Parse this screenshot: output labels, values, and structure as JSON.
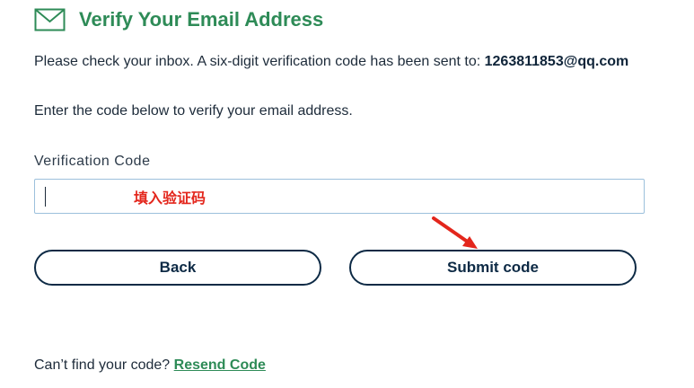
{
  "header": {
    "icon": "envelope-icon",
    "title": "Verify Your Email Address",
    "accent_color": "#2e8b57"
  },
  "message": {
    "sent_text": "Please check your inbox. A six-digit verification code has been sent to:",
    "email": "1263811853@qq.com",
    "instruction": "Enter the code below to verify your email address."
  },
  "form": {
    "code_label": "Verification Code",
    "code_value": "",
    "annotation_text": "填入验证码",
    "annotation_color": "#e3261c"
  },
  "buttons": {
    "back_label": "Back",
    "submit_label": "Submit code",
    "border_color": "#0d2a45"
  },
  "footer": {
    "prompt": "Can’t find your code?",
    "resend_label": "Resend Code"
  }
}
